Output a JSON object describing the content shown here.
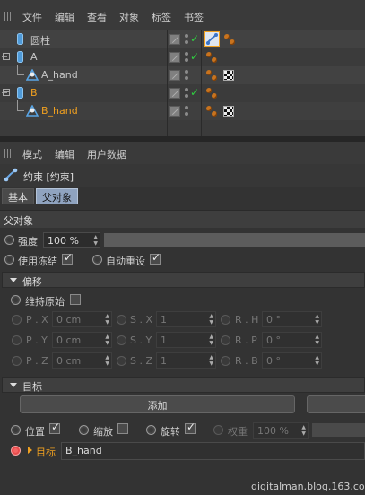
{
  "object_manager": {
    "menu": [
      "文件",
      "编辑",
      "查看",
      "对象",
      "标签",
      "书签"
    ],
    "objects": [
      {
        "name": "圆柱"
      },
      {
        "name": "A"
      },
      {
        "name": "A_hand"
      },
      {
        "name": "B"
      },
      {
        "name": "B_hand"
      }
    ]
  },
  "attribute_manager": {
    "menu": [
      "模式",
      "编辑",
      "用户数据"
    ],
    "header_title": "约束 [约束]",
    "tabs": [
      "基本",
      "父对象"
    ],
    "section_title": "父对象",
    "strength_label": "强度",
    "strength_value": "100 %",
    "freeze_label": "使用冻结",
    "auto_reset_label": "自动重设",
    "offset": {
      "title": "偏移",
      "keep_original_label": "维持原始",
      "fields": {
        "px": {
          "label": "P . X",
          "value": "0 cm"
        },
        "py": {
          "label": "P . Y",
          "value": "0 cm"
        },
        "pz": {
          "label": "P . Z",
          "value": "0 cm"
        },
        "sx": {
          "label": "S . X",
          "value": "1"
        },
        "sy": {
          "label": "S . Y",
          "value": "1"
        },
        "sz": {
          "label": "S . Z",
          "value": "1"
        },
        "rh": {
          "label": "R . H",
          "value": "0 °"
        },
        "rp": {
          "label": "R . P",
          "value": "0 °"
        },
        "rb": {
          "label": "R . B",
          "value": "0 °"
        }
      }
    },
    "target": {
      "title": "目标",
      "add_button": "添加",
      "position_label": "位置",
      "scale_label": "缩放",
      "rotation_label": "旋转",
      "weight_label": "权重",
      "weight_value": "100 %",
      "target_label": "目标",
      "target_value": "B_hand"
    }
  },
  "watermark": "digitalman.blog.163.com",
  "colors": {
    "accent_orange": "#f0a020",
    "check_green": "#2fcf40",
    "tab_active": "#8fa3bf"
  }
}
